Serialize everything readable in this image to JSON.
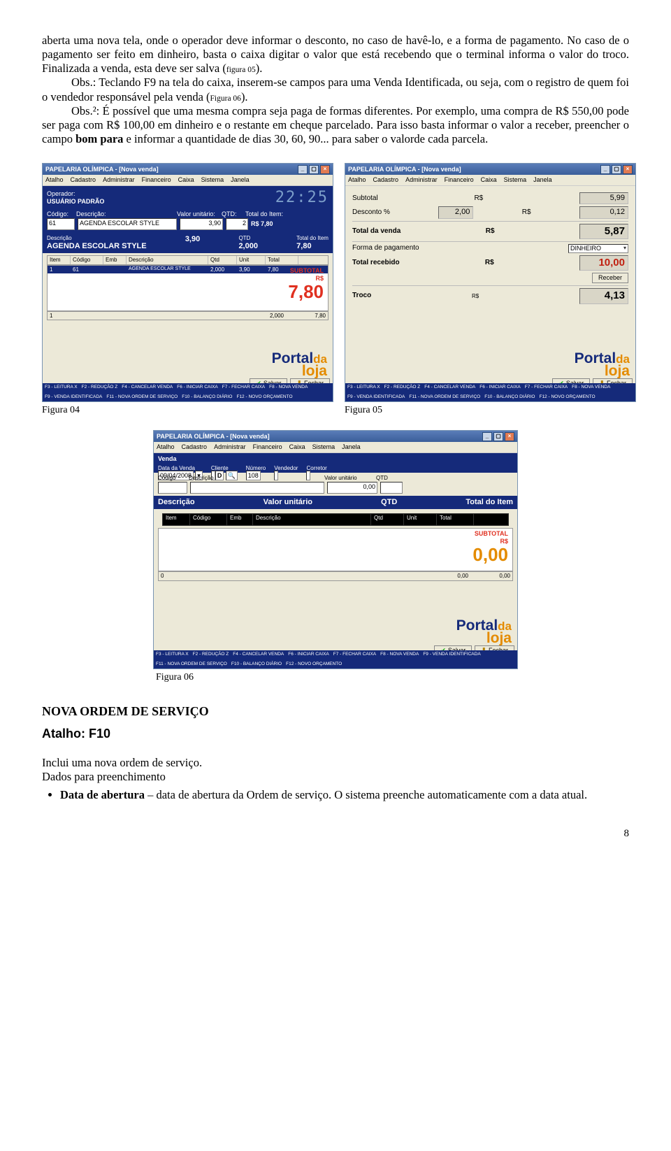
{
  "para1_a": "aberta uma nova tela, onde o operador deve informar o desconto, no caso de havê-lo, e a forma de pagamento. No caso de o pagamento ser feito em dinheiro, basta o caixa digitar o valor que está recebendo que o terminal informa o valor do troco. Finalizada a venda, esta deve ser salva (",
  "para1_fig": "figura 05",
  "para1_b": ").",
  "obs1_a": "Obs.: Teclando F9 na tela do caixa, inserem-se campos para uma Venda Identificada, ou seja, com o registro de quem foi o vendedor responsável pela venda (",
  "obs1_fig": "Figura 06",
  "obs1_b": ").",
  "obs2_a": "Obs.²: É possível que uma mesma compra seja paga de formas diferentes. Por exemplo, uma compra de R$ 550,00 pode ser paga com R$ 100,00 em dinheiro e o restante em cheque parcelado. Para isso basta informar o valor a receber, preencher o campo ",
  "obs2_bold": "bom para",
  "obs2_b": " e informar a quantidade de dias 30, 60, 90... para saber o valorde cada parcela.",
  "caption04": "Figura 04",
  "caption05": "Figura 05",
  "caption06": "Figura 06",
  "app_title": "PAPELARIA OLÍMPICA - [Nova venda]",
  "menu": [
    "Atalho",
    "Cadastro",
    "Administrar",
    "Financeiro",
    "Caixa",
    "Sistema",
    "Janela"
  ],
  "s04": {
    "op_lbl": "Operador:",
    "op_name": "USUÁRIO PADRÃO",
    "clock": "22:25",
    "hdr": [
      "Código:",
      "Descrição:",
      "Valor unitário:",
      "QTD:",
      "Total do Item:"
    ],
    "row": [
      "61",
      "AGENDA ESCOLAR STYLE",
      "3,90",
      "2",
      "R$ 7,80"
    ],
    "big_desc_lbl": "Descrição",
    "big_desc": "AGENDA ESCOLAR STYLE",
    "big_unit": "3,90",
    "big_qtd_lbl": "QTD",
    "big_qtd": "2,000",
    "big_tot_lbl": "Total do Item",
    "big_tot": "7,80",
    "grid_cols": [
      "Item",
      "Código",
      "Emb",
      "Descrição",
      "Qtd",
      "Unit",
      "Total"
    ],
    "grid_item": [
      "1",
      "61",
      "",
      "AGENDA ESCOLAR STYLE",
      "2,000",
      "3,90",
      "7,80"
    ],
    "sub_lbl": "SUBTOTAL",
    "sub_rs": "R$",
    "sub_val": "7,80",
    "foot_qtd": "2,000",
    "foot_tot": "7,80",
    "btn_salvar": "Salvar",
    "btn_fechar": "Fechar",
    "fkeys": [
      "F3 - LEITURA X",
      "F2 - REDUÇÃO Z",
      "F4 - CANCELAR VENDA",
      "F6 - INICIAR CAIXA",
      "F7 - FECHAR CAIXA",
      "F8 - NOVA VENDA",
      "F9 - VENDA IDENTIFICADA",
      "F11 - NOVA ORDEM DE SERVIÇO",
      "F10 - BALANÇO DIÁRIO",
      "F12 - NOVO ORÇAMENTO"
    ]
  },
  "s05": {
    "subtotal_lbl": "Subtotal",
    "subtotal_rs": "R$",
    "subtotal_val": "5,99",
    "desc_lbl": "Desconto  %",
    "desc_pct": "2,00",
    "desc_rs": "R$",
    "desc_val": "0,12",
    "total_lbl": "Total da venda",
    "total_rs": "R$",
    "total_val": "5,87",
    "forma_lbl": "Forma de pagamento",
    "forma_val": "DINHEIRO",
    "receb_lbl": "Total recebido",
    "receb_rs": "R$",
    "receb_val": "10,00",
    "btn_receber": "Receber",
    "troco_lbl": "Troco",
    "troco_rs": "R$",
    "troco_val": "4,13",
    "btn_salvar": "Salvar",
    "btn_fechar": "Fechar"
  },
  "s06": {
    "venda_lbl": "Venda",
    "data_lbl": "Data da Venda",
    "data_val": "09/04/2008",
    "cliente_lbl": "Cliente",
    "num_lbl": "Número",
    "num_val": "108",
    "vend_lbl": "Vendedor",
    "corr_lbl": "Corretor",
    "d_icon": "D",
    "hdr": [
      "Código",
      "Descrição",
      "Valor unitário",
      "QTD"
    ],
    "vu_zero": "0,00",
    "big_cols": [
      "Descrição",
      "Valor unitário",
      "QTD",
      "Total do Item"
    ],
    "grid_cols": [
      "Item",
      "Código",
      "Emb",
      "Descrição",
      "Qtd",
      "Unit",
      "Total"
    ],
    "sub_lbl": "SUBTOTAL",
    "sub_rs": "R$",
    "sub_val": "0,00",
    "foot_qtd": "0",
    "foot_vu": "0,00",
    "foot_tot": "0,00",
    "btn_salvar": "Salvar",
    "btn_fechar": "Fechar",
    "fkeys": [
      "F3 - LEITURA X",
      "F2 - REDUÇÃO Z",
      "F4 - CANCELAR VENDA",
      "F6 - INICIAR CAIXA",
      "F7 - FECHAR CAIXA",
      "F8 - NOVA VENDA",
      "F9 - VENDA IDENTIFICADA",
      "F11 - NOVA ORDEM DE SERVIÇO",
      "F10 - BALANÇO DIÁRIO",
      "F12 - NOVO ORÇAMENTO"
    ]
  },
  "section_title": "NOVA ORDEM DE SERVIÇO",
  "atalho": "Atalho: F10",
  "line_inclui": "Inclui uma nova ordem de serviço.",
  "line_dados": "Dados para preenchimento",
  "bullet_bold": "Data de abertura",
  "bullet_rest": " – data de abertura da Ordem de serviço. O sistema preenche automaticamente com a data atual.",
  "pgnum": "8",
  "logo_a": "Portal",
  "logo_b": "da",
  "logo_c": "loja"
}
